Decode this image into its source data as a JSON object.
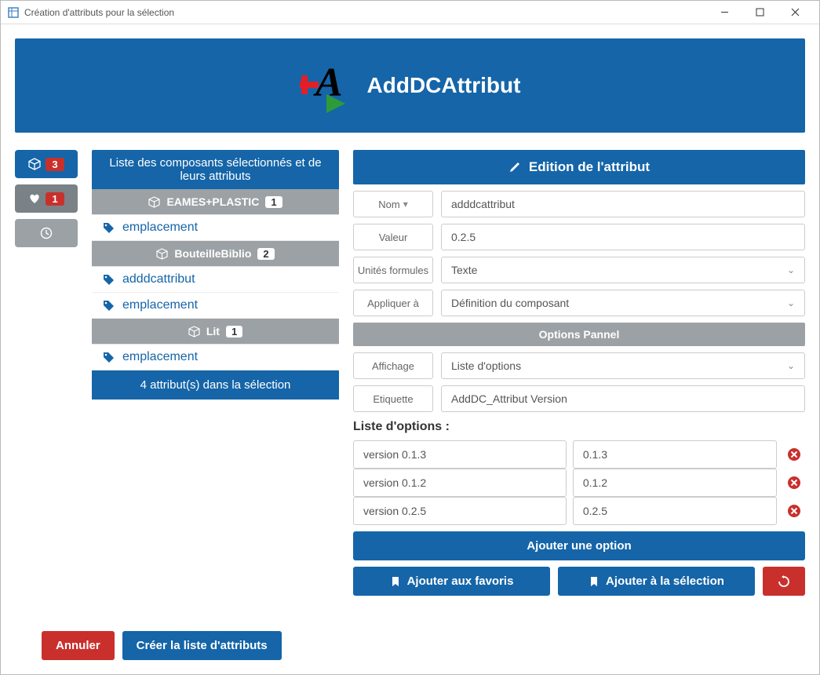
{
  "window": {
    "title": "Création d'attributs pour la sélection"
  },
  "banner": {
    "title": "AddDCAttribut"
  },
  "sidebar": {
    "cube_count": "3",
    "fav_count": "1"
  },
  "middle": {
    "header": "Liste des composants sélectionnés et de leurs attributs",
    "footer": "4 attribut(s) dans la sélection",
    "components": [
      {
        "name": "EAMES+PLASTIC",
        "count": "1",
        "attrs": [
          "emplacement"
        ]
      },
      {
        "name": "BouteilleBiblio",
        "count": "2",
        "attrs": [
          "adddcattribut",
          "emplacement"
        ]
      },
      {
        "name": "Lit",
        "count": "1",
        "attrs": [
          "emplacement"
        ]
      }
    ]
  },
  "editor": {
    "title": "Edition de l'attribut",
    "labels": {
      "nom": "Nom",
      "valeur": "Valeur",
      "unites": "Unités formules",
      "appliquer": "Appliquer à",
      "options_pannel": "Options Pannel",
      "affichage": "Affichage",
      "etiquette": "Etiquette"
    },
    "values": {
      "nom": "adddcattribut",
      "valeur": "0.2.5",
      "unites": "Texte",
      "appliquer": "Définition du composant",
      "affichage": "Liste d'options",
      "etiquette": "AddDC_Attribut Version"
    },
    "options_title": "Liste d'options :",
    "options": [
      {
        "name": "version 0.1.3",
        "value": "0.1.3"
      },
      {
        "name": "version 0.1.2",
        "value": "0.1.2"
      },
      {
        "name": "version 0.2.5",
        "value": "0.2.5"
      }
    ],
    "add_option": "Ajouter une option",
    "add_fav": "Ajouter aux favoris",
    "add_sel": "Ajouter à la sélection"
  },
  "footer": {
    "cancel": "Annuler",
    "create": "Créer la liste d'attributs"
  }
}
